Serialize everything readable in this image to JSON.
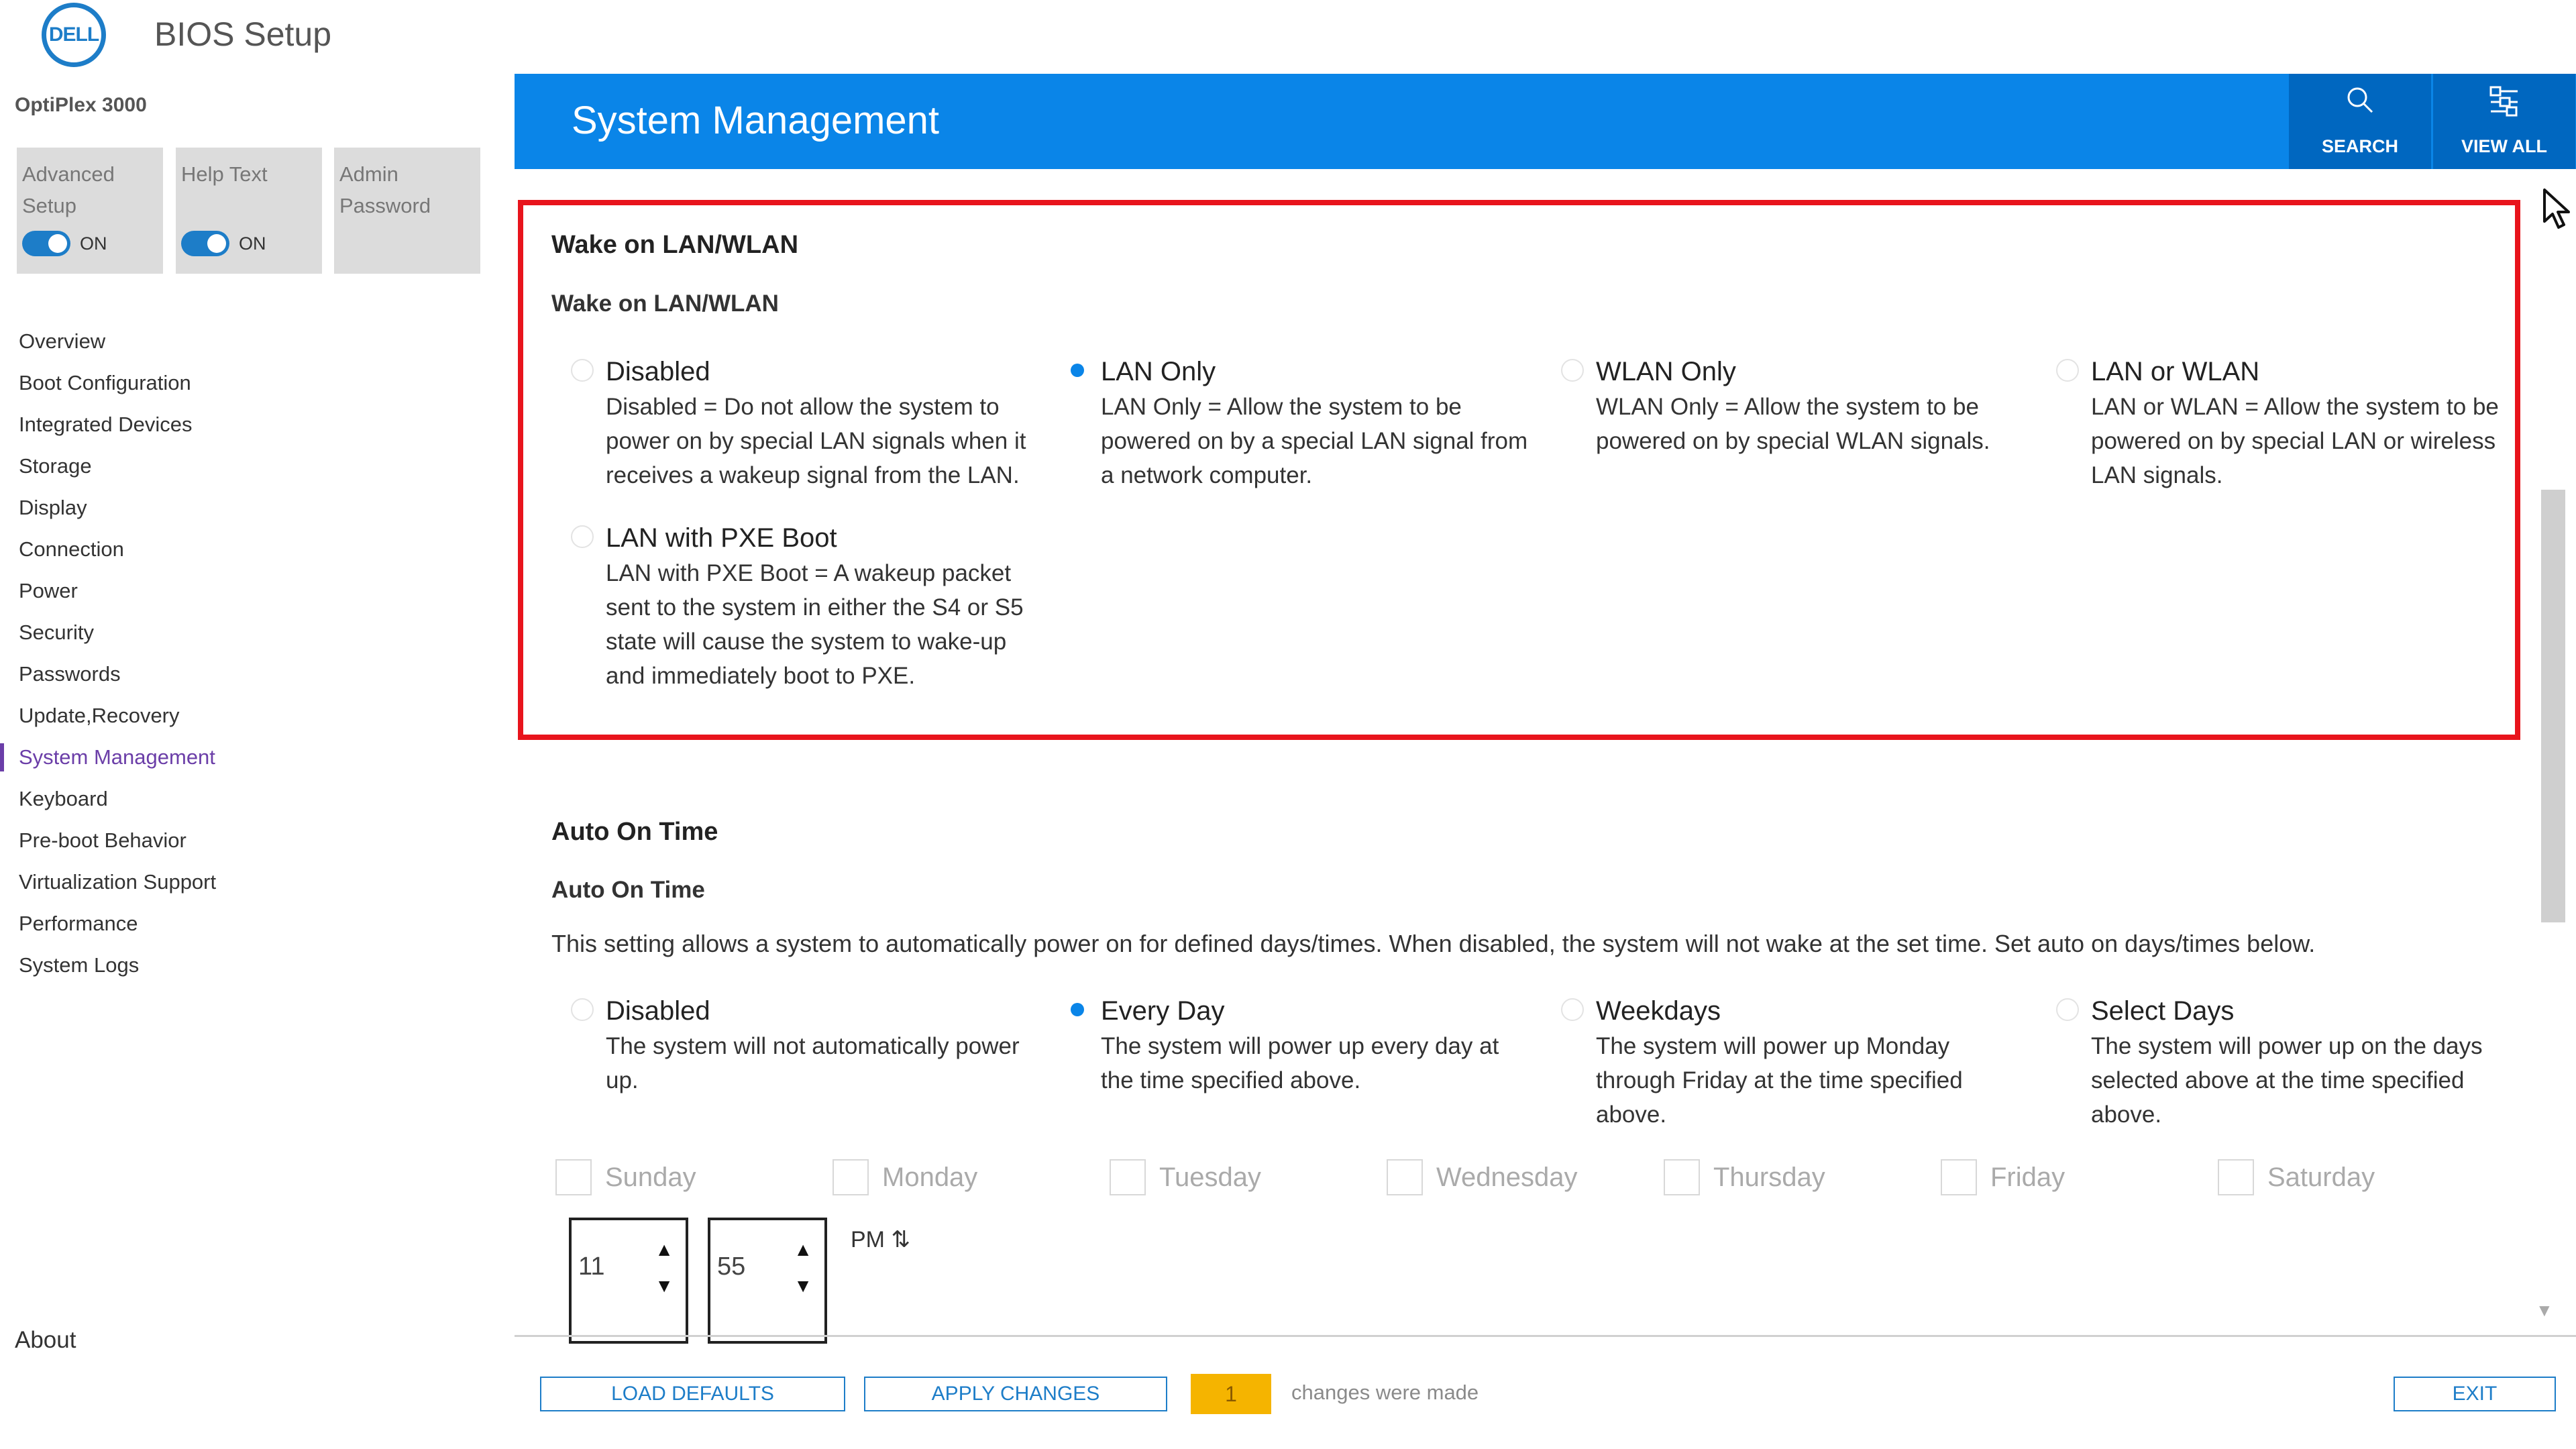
{
  "app": {
    "logo_text": "DELL",
    "title": "BIOS Setup",
    "model": "OptiPlex 3000"
  },
  "tiles": {
    "advanced_setup": {
      "label_line1": "Advanced",
      "label_line2": "Setup",
      "toggle": "ON"
    },
    "help_text": {
      "label": "Help Text",
      "toggle": "ON"
    },
    "admin_password": {
      "label_line1": "Admin",
      "label_line2": "Password"
    }
  },
  "nav": {
    "items": [
      "Overview",
      "Boot Configuration",
      "Integrated Devices",
      "Storage",
      "Display",
      "Connection",
      "Power",
      "Security",
      "Passwords",
      "Update,Recovery",
      "System Management",
      "Keyboard",
      "Pre-boot Behavior",
      "Virtualization Support",
      "Performance",
      "System Logs"
    ],
    "active": "System Management",
    "about": "About"
  },
  "header": {
    "title": "System Management",
    "search_label": "SEARCH",
    "view_all_label": "VIEW ALL"
  },
  "wake": {
    "section_title": "Wake on LAN/WLAN",
    "sub_title": "Wake on LAN/WLAN",
    "options": [
      {
        "title": "Disabled",
        "selected": false,
        "desc": [
          "Disabled = Do not allow the system to",
          "power on by special LAN signals when it",
          "receives a wakeup signal from the LAN."
        ]
      },
      {
        "title": "LAN Only",
        "selected": true,
        "desc": [
          "LAN Only = Allow the system to be",
          "powered on by a special LAN signal from",
          "a network computer."
        ]
      },
      {
        "title": "WLAN Only",
        "selected": false,
        "desc": [
          "WLAN Only = Allow the system to be",
          "powered on by special WLAN signals."
        ]
      },
      {
        "title": "LAN or WLAN",
        "selected": false,
        "desc": [
          "LAN or WLAN = Allow the system to be",
          "powered on by special LAN or wireless",
          "LAN signals."
        ]
      },
      {
        "title": "LAN with PXE Boot",
        "selected": false,
        "desc": [
          "LAN with PXE Boot = A wakeup packet",
          "sent to the system in either the S4 or S5",
          "state will cause the system to wake-up",
          "and immediately boot to PXE."
        ]
      }
    ]
  },
  "auto_on": {
    "section_title": "Auto On Time",
    "sub_title": "Auto On Time",
    "description": "This setting allows a system to automatically power on for defined days/times. When disabled, the system will not wake at the set time. Set auto on days/times below.",
    "options": [
      {
        "title": "Disabled",
        "selected": false,
        "desc": [
          "The system will not automatically power",
          "up."
        ]
      },
      {
        "title": "Every Day",
        "selected": true,
        "desc": [
          "The system will power up every day at",
          "the time specified above."
        ]
      },
      {
        "title": "Weekdays",
        "selected": false,
        "desc": [
          "The system will power up Monday",
          "through Friday at the time specified",
          "above."
        ]
      },
      {
        "title": "Select Days",
        "selected": false,
        "desc": [
          "The system will power up on the days",
          "selected above at the time specified",
          "above."
        ]
      }
    ],
    "days": [
      "Sunday",
      "Monday",
      "Tuesday",
      "Wednesday",
      "Thursday",
      "Friday",
      "Saturday"
    ],
    "hour": "11",
    "minute": "55",
    "ampm": "PM ⇅"
  },
  "footer": {
    "load_defaults": "LOAD DEFAULTS",
    "apply_changes": "APPLY CHANGES",
    "changes_count": "1",
    "changes_text": "changes were made",
    "exit": "EXIT"
  },
  "colors": {
    "accent": "#0a85e8",
    "header_button": "#0067c0",
    "highlight_border": "#e8141c",
    "nav_active": "#6b3ea8",
    "changes_badge": "#f5b400"
  }
}
